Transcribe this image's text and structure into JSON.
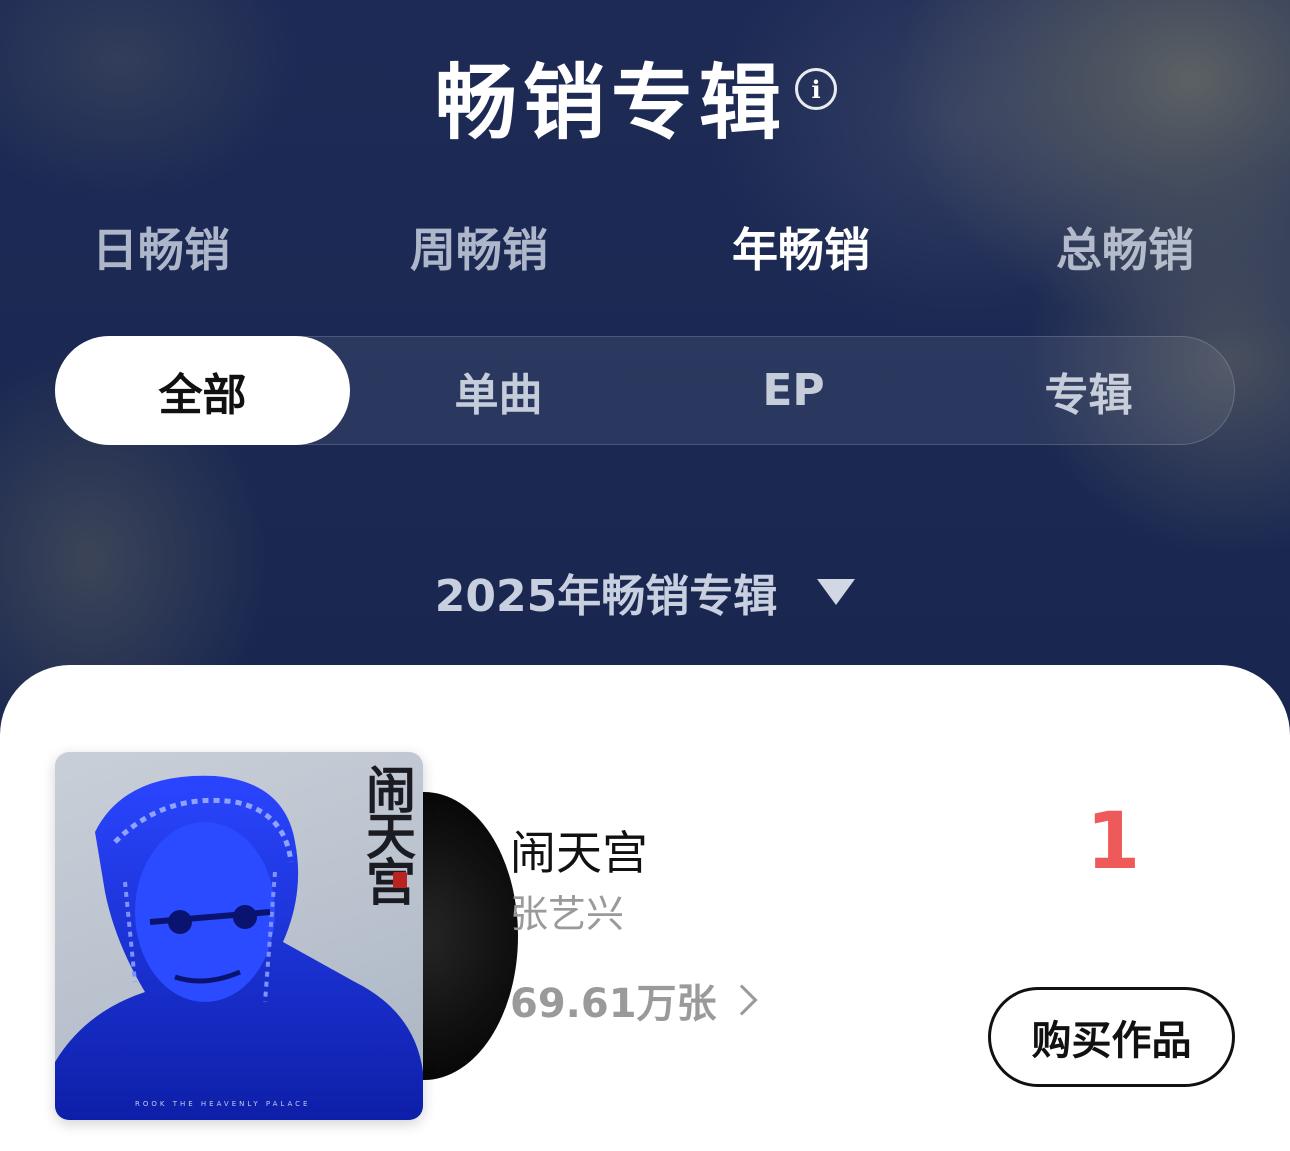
{
  "header": {
    "title": "畅销专辑",
    "info_icon": "info-icon",
    "info_glyph": "i"
  },
  "period_tabs": [
    {
      "label": "日畅销",
      "active": false
    },
    {
      "label": "周畅销",
      "active": false
    },
    {
      "label": "年畅销",
      "active": true
    },
    {
      "label": "总畅销",
      "active": false
    }
  ],
  "type_tabs": [
    {
      "label": "全部",
      "active": true
    },
    {
      "label": "单曲",
      "active": false
    },
    {
      "label": "EP",
      "active": false
    },
    {
      "label": "专辑",
      "active": false
    }
  ],
  "year_select": {
    "label": "2025年畅销专辑",
    "icon": "caret-down-icon"
  },
  "albums": [
    {
      "rank": "1",
      "title": "闹天宫",
      "artist": "张艺兴",
      "sales": "69.61万张",
      "buy_label": "购买作品",
      "cover_title": "闹天宫",
      "cover_caption": "ROOK THE HEAVENLY PALACE",
      "cover_tint": "#1f3cff"
    }
  ],
  "colors": {
    "background": "#1b2748",
    "rank_color": "#ee5a5a",
    "card": "#ffffff"
  }
}
